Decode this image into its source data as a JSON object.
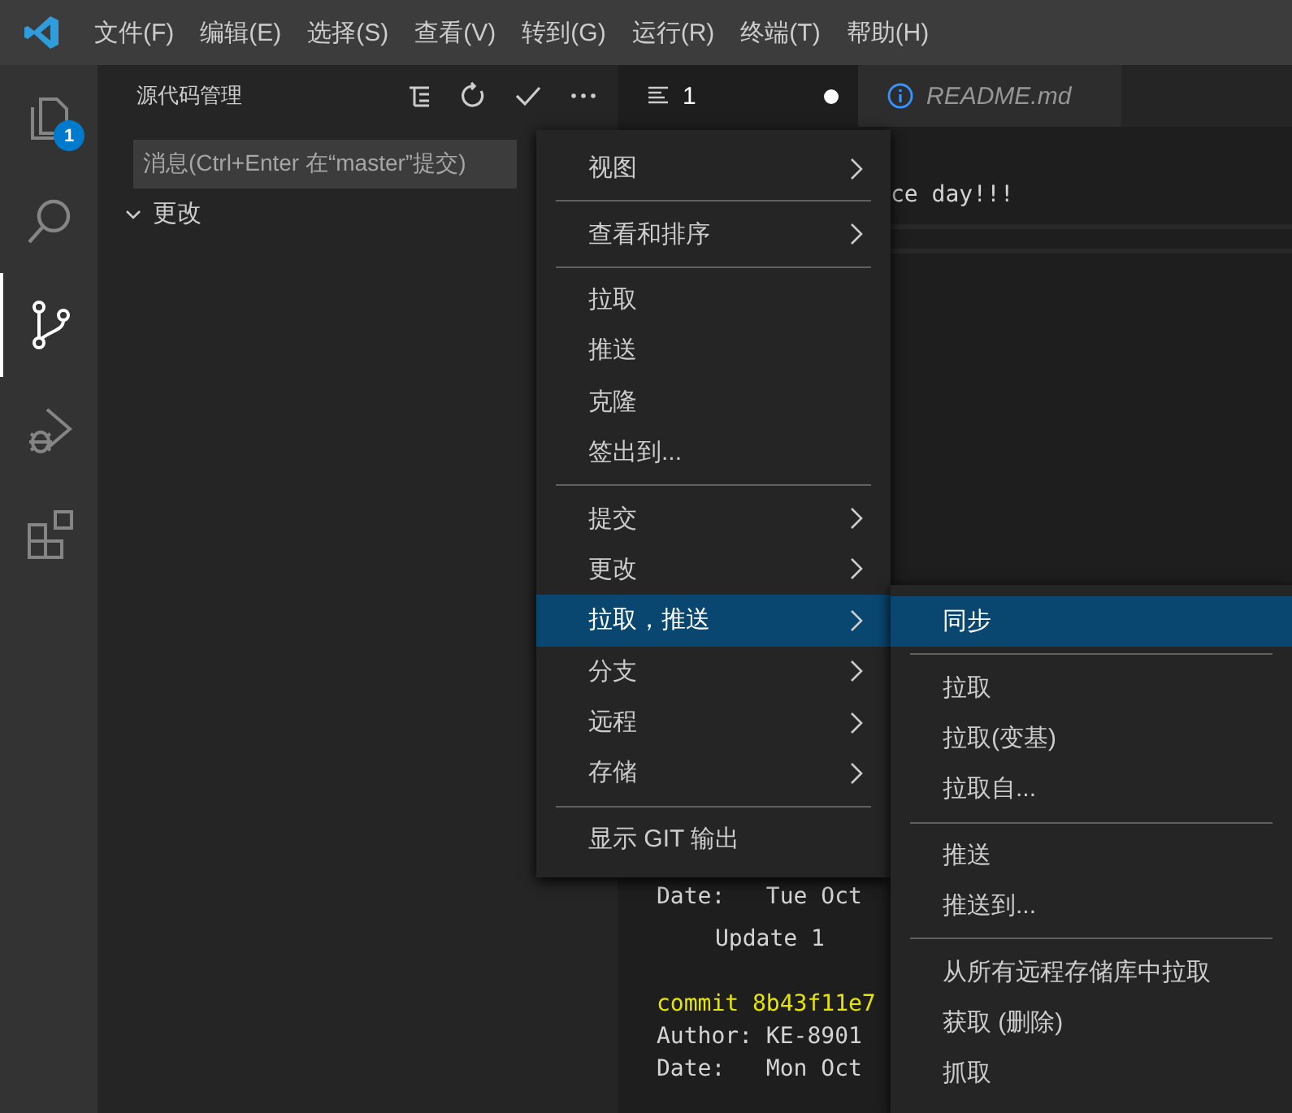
{
  "menu_bar": [
    {
      "label": "文件(F)"
    },
    {
      "label": "编辑(E)"
    },
    {
      "label": "选择(S)"
    },
    {
      "label": "查看(V)"
    },
    {
      "label": "转到(G)"
    },
    {
      "label": "运行(R)"
    },
    {
      "label": "终端(T)"
    },
    {
      "label": "帮助(H)"
    }
  ],
  "activity_bar": [
    {
      "kind": "files",
      "selected": false,
      "badge": "1"
    },
    {
      "kind": "search",
      "selected": false
    },
    {
      "kind": "scm",
      "selected": true
    },
    {
      "kind": "debug",
      "selected": false
    },
    {
      "kind": "extensions",
      "selected": false
    }
  ],
  "sidebar": {
    "title": "源代码管理",
    "message": {
      "placeholder": "消息(Ctrl+Enter 在“master”提交)"
    },
    "section": {
      "label": "更改",
      "expanded": true
    }
  },
  "tabs": [
    {
      "label": "1",
      "kind": "list",
      "selected": true,
      "dirty": true
    },
    {
      "label": "README.md",
      "kind": "info",
      "selected": false,
      "dirty": false
    }
  ],
  "editor": {
    "lines": [
      {
        "text": "ce day!!!",
        "kind": "clipped"
      },
      {
        "text": "Date:   Tue Oct",
        "kind": "plain"
      },
      {
        "text": "Update 1",
        "kind": "message"
      },
      {
        "text": "commit 8b43f11e7",
        "kind": "commit"
      },
      {
        "text": "Author: KE-8901",
        "kind": "plain"
      },
      {
        "text": "Date:   Mon Oct",
        "kind": "plain"
      }
    ]
  },
  "context_menu": [
    {
      "kind": "item",
      "label": "视图",
      "submenu": true,
      "selected": false
    },
    {
      "kind": "separator"
    },
    {
      "kind": "item",
      "label": "查看和排序",
      "submenu": true,
      "selected": false
    },
    {
      "kind": "separator"
    },
    {
      "kind": "item",
      "label": "拉取",
      "submenu": false,
      "selected": false
    },
    {
      "kind": "item",
      "label": "推送",
      "submenu": false,
      "selected": false
    },
    {
      "kind": "item",
      "label": "克隆",
      "submenu": false,
      "selected": false
    },
    {
      "kind": "item",
      "label": "签出到...",
      "submenu": false,
      "selected": false
    },
    {
      "kind": "separator"
    },
    {
      "kind": "item",
      "label": "提交",
      "submenu": true,
      "selected": false
    },
    {
      "kind": "item",
      "label": "更改",
      "submenu": true,
      "selected": false
    },
    {
      "kind": "item",
      "label": "拉取，推送",
      "submenu": true,
      "selected": true
    },
    {
      "kind": "item",
      "label": "分支",
      "submenu": true,
      "selected": false
    },
    {
      "kind": "item",
      "label": "远程",
      "submenu": true,
      "selected": false
    },
    {
      "kind": "item",
      "label": "存储",
      "submenu": true,
      "selected": false
    },
    {
      "kind": "separator"
    },
    {
      "kind": "item",
      "label": "显示 GIT 输出",
      "submenu": false,
      "selected": false
    }
  ],
  "submenu": [
    {
      "kind": "item",
      "label": "同步",
      "submenu": false,
      "selected": true
    },
    {
      "kind": "separator"
    },
    {
      "kind": "item",
      "label": "拉取",
      "submenu": false,
      "selected": false
    },
    {
      "kind": "item",
      "label": "拉取(变基)",
      "submenu": false,
      "selected": false
    },
    {
      "kind": "item",
      "label": "拉取自...",
      "submenu": false,
      "selected": false
    },
    {
      "kind": "separator"
    },
    {
      "kind": "item",
      "label": "推送",
      "submenu": false,
      "selected": false
    },
    {
      "kind": "item",
      "label": "推送到...",
      "submenu": false,
      "selected": false
    },
    {
      "kind": "separator"
    },
    {
      "kind": "item",
      "label": "从所有远程存储库中拉取",
      "submenu": false,
      "selected": false
    },
    {
      "kind": "item",
      "label": "获取 (删除)",
      "submenu": false,
      "selected": false
    },
    {
      "kind": "item",
      "label": "抓取",
      "submenu": false,
      "selected": false
    }
  ]
}
